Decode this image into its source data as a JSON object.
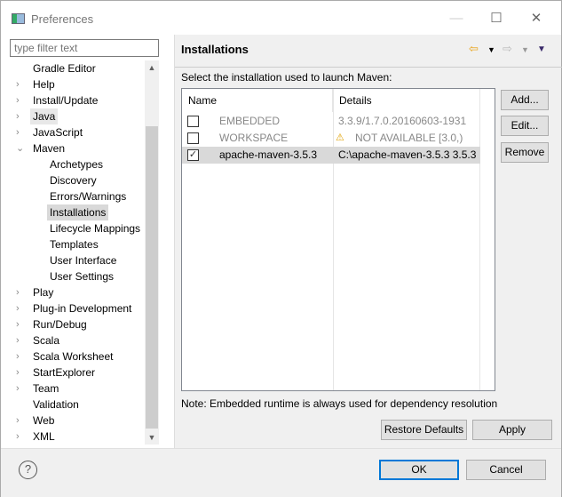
{
  "window": {
    "title": "Preferences",
    "minimize": "—",
    "maximize": "☐",
    "close": "✕"
  },
  "filter": {
    "placeholder": "type filter text"
  },
  "tree": [
    {
      "label": "Gradle Editor",
      "level": 0,
      "arrow": ""
    },
    {
      "label": "Help",
      "level": 0,
      "arrow": "›"
    },
    {
      "label": "Install/Update",
      "level": 0,
      "arrow": "›"
    },
    {
      "label": "Java",
      "level": 0,
      "arrow": "›",
      "state": "hover"
    },
    {
      "label": "JavaScript",
      "level": 0,
      "arrow": "›"
    },
    {
      "label": "Maven",
      "level": 0,
      "arrow": "⌄"
    },
    {
      "label": "Archetypes",
      "level": 1,
      "arrow": ""
    },
    {
      "label": "Discovery",
      "level": 1,
      "arrow": ""
    },
    {
      "label": "Errors/Warnings",
      "level": 1,
      "arrow": ""
    },
    {
      "label": "Installations",
      "level": 1,
      "arrow": "",
      "state": "selected"
    },
    {
      "label": "Lifecycle Mappings",
      "level": 1,
      "arrow": ""
    },
    {
      "label": "Templates",
      "level": 1,
      "arrow": ""
    },
    {
      "label": "User Interface",
      "level": 1,
      "arrow": ""
    },
    {
      "label": "User Settings",
      "level": 1,
      "arrow": ""
    },
    {
      "label": "Play",
      "level": 0,
      "arrow": "›"
    },
    {
      "label": "Plug-in Development",
      "level": 0,
      "arrow": "›"
    },
    {
      "label": "Run/Debug",
      "level": 0,
      "arrow": "›"
    },
    {
      "label": "Scala",
      "level": 0,
      "arrow": "›"
    },
    {
      "label": "Scala Worksheet",
      "level": 0,
      "arrow": "›"
    },
    {
      "label": "StartExplorer",
      "level": 0,
      "arrow": "›"
    },
    {
      "label": "Team",
      "level": 0,
      "arrow": "›"
    },
    {
      "label": "Validation",
      "level": 0,
      "arrow": ""
    },
    {
      "label": "Web",
      "level": 0,
      "arrow": "›"
    },
    {
      "label": "XML",
      "level": 0,
      "arrow": "›"
    }
  ],
  "page": {
    "title": "Installations",
    "description": "Select the installation used to launch Maven:",
    "note": "Note: Embedded runtime is always used for dependency resolution"
  },
  "table": {
    "columns": [
      "Name",
      "Details"
    ],
    "rows": [
      {
        "checked": false,
        "name": "EMBEDDED",
        "details": "3.3.9/1.7.0.20160603-1931",
        "warning": false,
        "dimmed": true
      },
      {
        "checked": false,
        "name": "WORKSPACE",
        "details": "NOT AVAILABLE [3.0,)",
        "warning": true,
        "dimmed": true
      },
      {
        "checked": true,
        "name": "apache-maven-3.5.3",
        "details": "C:\\apache-maven-3.5.3 3.5.3",
        "warning": false,
        "dimmed": false,
        "selected": true
      }
    ]
  },
  "buttons": {
    "add": "Add...",
    "edit": "Edit...",
    "remove": "Remove",
    "restore": "Restore Defaults",
    "apply": "Apply",
    "ok": "OK",
    "cancel": "Cancel",
    "help": "?"
  },
  "colors": {
    "selection": "#d9d9d9",
    "accent": "#0078d7",
    "back_arrow": "#e8a317"
  }
}
